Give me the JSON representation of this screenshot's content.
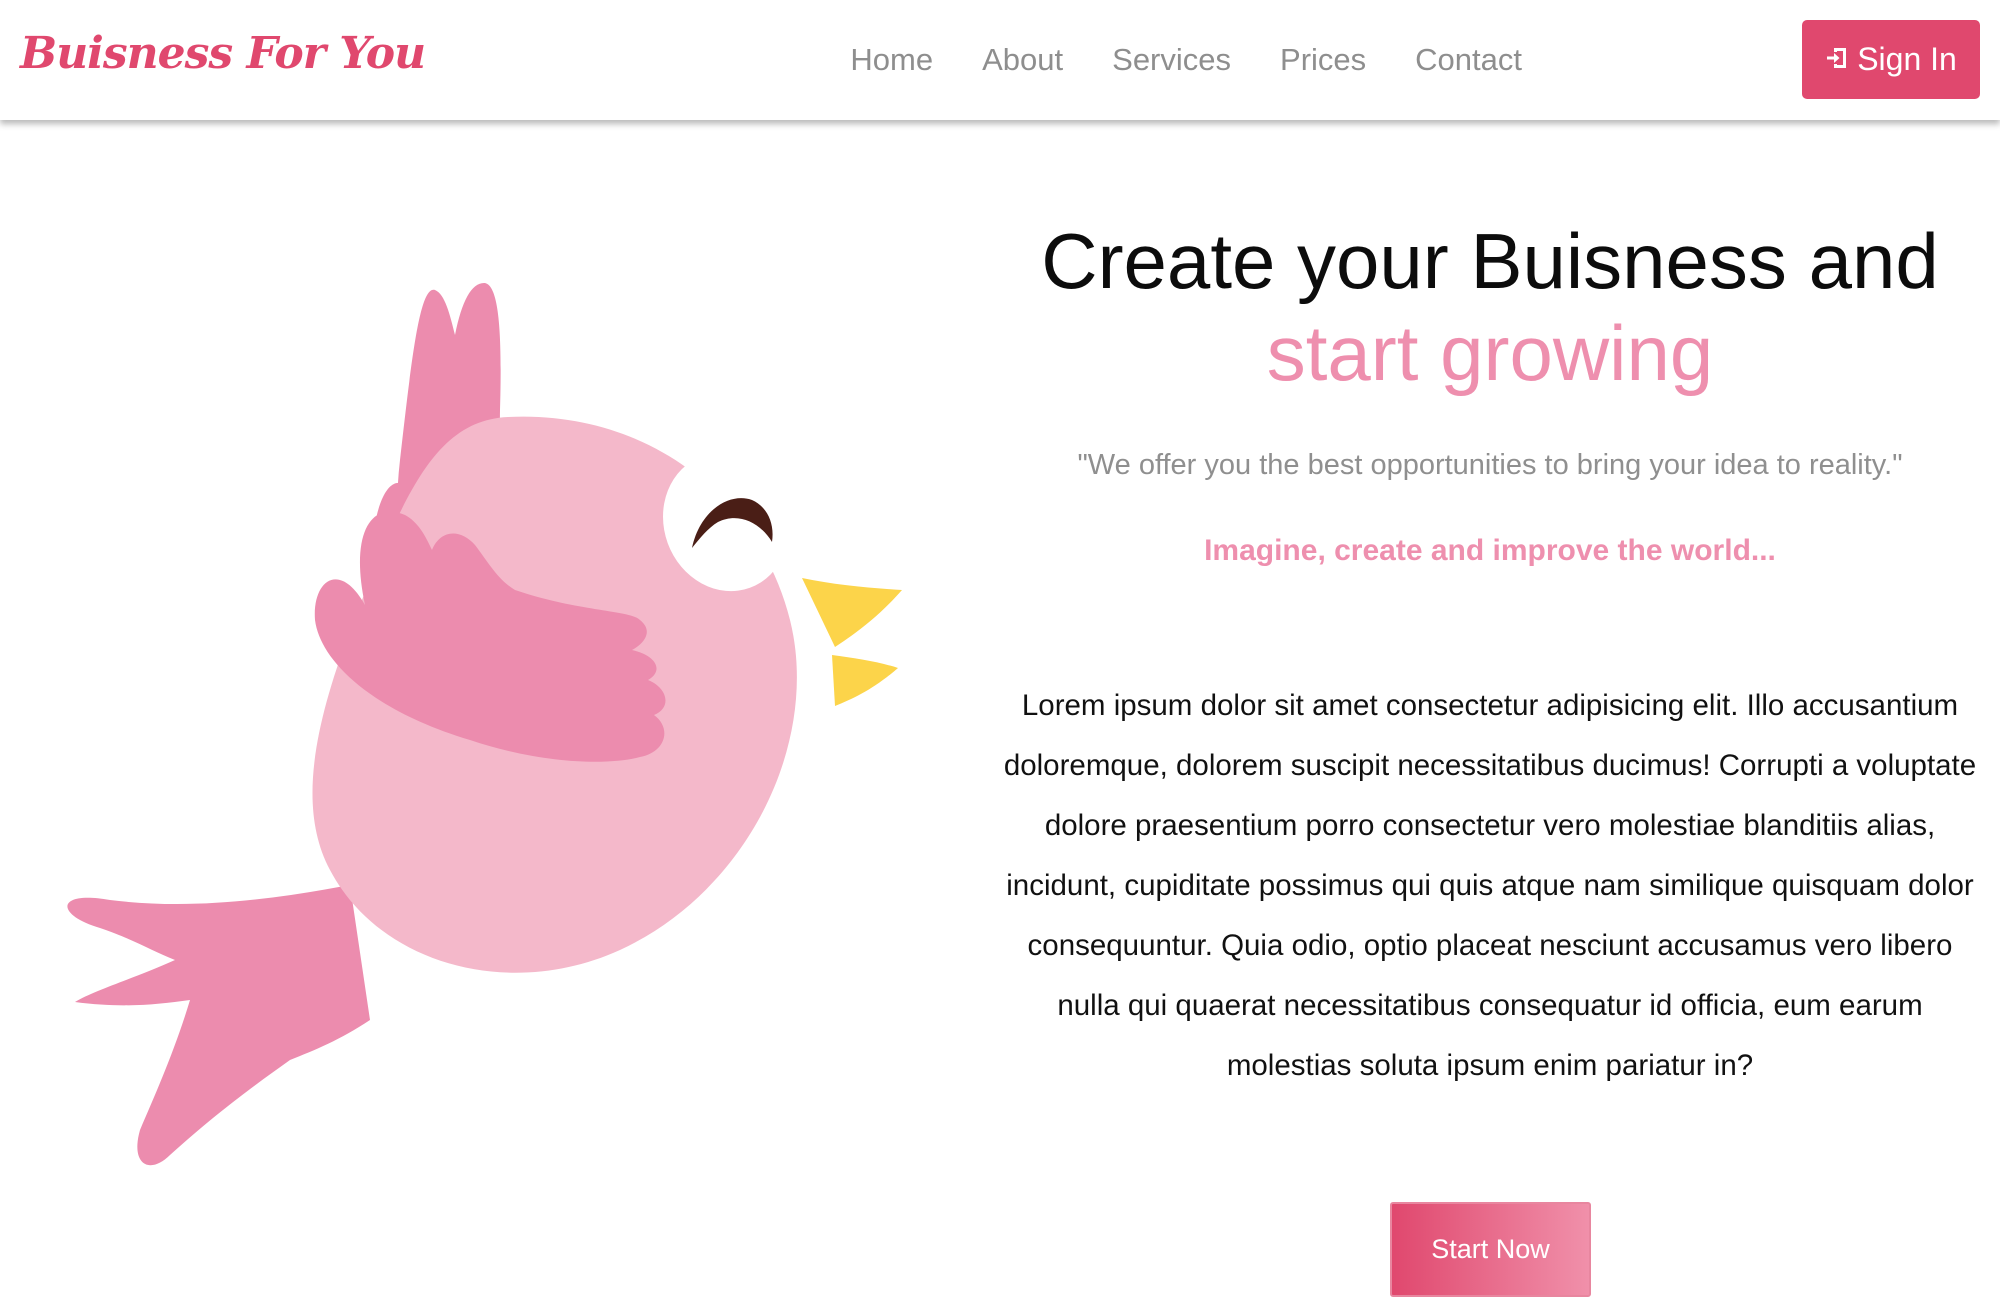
{
  "brand": {
    "name": "Buisness For You"
  },
  "nav": {
    "items": [
      {
        "label": "Home"
      },
      {
        "label": "About"
      },
      {
        "label": "Services"
      },
      {
        "label": "Prices"
      },
      {
        "label": "Contact"
      }
    ],
    "signin": {
      "label": "Sign In",
      "icon": "sign-in-icon"
    }
  },
  "hero": {
    "title_line1": "Create your Buisness and",
    "title_line2": "start growing",
    "quote": "\"We offer you the best opportunities to bring your idea to reality.\"",
    "tagline": "Imagine, create and improve the world...",
    "body": "Lorem ipsum dolor sit amet consectetur adipisicing elit. Illo accusantium doloremque, dolorem suscipit necessitatibus ducimus! Corrupti a voluptate dolore praesentium porro consectetur vero molestiae blanditiis alias, incidunt, cupiditate possimus qui quis atque nam similique quisquam dolor consequuntur. Quia odio, optio placeat nesciunt accusamus vero libero nulla qui quaerat necessitatibus consequatur id officia, eum earum molestias soluta ipsum enim pariatur in?",
    "cta_label": "Start Now",
    "illustration": "pink-bird-illustration"
  },
  "colors": {
    "brand": "#e0486e",
    "accent_pink": "#ee8fae",
    "nav_text": "#8e8e8e",
    "bird_body": "#f4b8ca",
    "bird_wing": "#ec8cae",
    "bird_beak": "#fcd44a"
  }
}
